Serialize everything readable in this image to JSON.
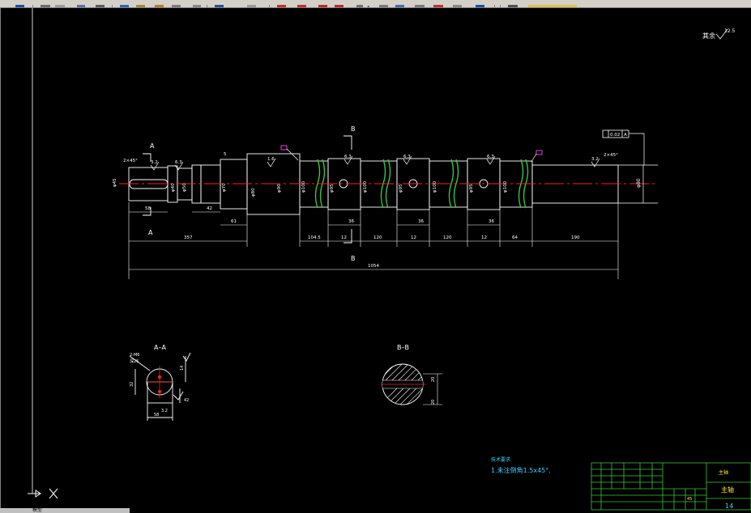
{
  "toolbar": {
    "tool_text_label": "A",
    "icons": [
      "save-icon",
      "print-icon",
      "preview-icon",
      "cut-icon",
      "copy-icon",
      "paste-icon",
      "match-properties-icon",
      "undo-icon",
      "redo-icon",
      "pan-icon",
      "zoom-realtime-icon",
      "zoom-window-icon",
      "zoom-previous-icon",
      "text-tool-icon",
      "properties-icon",
      "design-center-icon",
      "tool-palettes-icon",
      "calculator-icon",
      "help-icon",
      "layer-manager-icon",
      "layer-state-icon"
    ]
  },
  "drawing": {
    "roughness": {
      "text": "其余",
      "value": "12.5"
    },
    "section_labels": {
      "a_top": "A",
      "a_bottom": "A",
      "b_top": "B",
      "b_bottom": "B",
      "aa_title": "A–A",
      "bb_title": "B–B"
    },
    "chamfer_left": "2×45°",
    "chamfer_right": "2×45°",
    "surface_marks": {
      "s1": "3.2",
      "s2": "6.3",
      "s3": "1.6",
      "s4": "6.3",
      "s5": "6.3",
      "s6": "6.3",
      "s7": "3.2"
    },
    "left_diameter": "φ45",
    "dim_5": "5",
    "dia_labels": [
      "φ40",
      "φ50",
      "φ70",
      "φ80",
      "φ90",
      "φ100",
      "φ95",
      "φ100",
      "φ95",
      "φ100",
      "φ95",
      "φ100",
      "φ80"
    ],
    "tolerance_box": "0.02",
    "tolerance_ref": "A",
    "right_end_diameter": "φ80",
    "dims_row1": {
      "d1": "58",
      "d2": "42",
      "d3": "61",
      "d4": "36",
      "d5": "36",
      "d6": "36"
    },
    "dims_row2": {
      "d1": "357",
      "d2": "104.5",
      "d3": "12",
      "d4": "120",
      "d5": "12",
      "d6": "120",
      "d7": "12",
      "d8": "64",
      "d9": "190"
    },
    "total_length": "1054",
    "aa": {
      "dim_top": "14",
      "dim_left": "32",
      "dim_right": "42",
      "dim_bottom": "58",
      "slot_note": "2-M6",
      "depth_note": "深25",
      "rough": "3.2"
    },
    "bb": {
      "dim_right": "20",
      "dim_r2": "20"
    },
    "notes_title": "技术要求",
    "notes_line": "1.未注倒角1.5x45°.",
    "title_block": {
      "name_small": "主轴",
      "name_large": "主轴",
      "number": "14",
      "material": "45"
    },
    "status_bar": {
      "text": "模型"
    }
  }
}
